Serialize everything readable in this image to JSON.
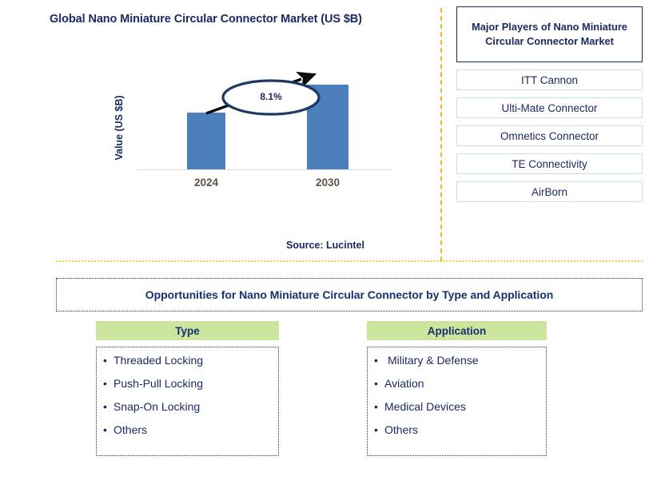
{
  "chart_title": "Global Nano Miniature Circular Connector Market (US $B)",
  "source_note": "Source: Lucintel",
  "chart_data": {
    "type": "bar",
    "title": "Global Nano Miniature Circular Connector Market (US $B)",
    "categories": [
      "2024",
      "2030"
    ],
    "values": [
      60,
      90
    ],
    "series": [
      {
        "name": "Value (US $B)",
        "values": [
          60,
          90
        ]
      }
    ],
    "xlabel": "",
    "ylabel": "Value (US $B)",
    "ylim": [
      0,
      100
    ],
    "grid": false,
    "legend": "none",
    "bar_color": "#4d7fbd",
    "annotations": [
      {
        "text": "8.1%",
        "type": "cagr-callout",
        "between": [
          "2024",
          "2030"
        ]
      }
    ]
  },
  "axis": {
    "y_label": "Value (US $B)",
    "x_ticks": [
      "2024",
      "2030"
    ]
  },
  "cagr": {
    "value": "8.1%"
  },
  "players": {
    "title": "Major Players of Nano Miniature Circular Connector Market",
    "items": [
      {
        "label": "ITT Cannon"
      },
      {
        "label": "Ulti-Mate Connector"
      },
      {
        "label": "Omnetics Connector"
      },
      {
        "label": "TE Connectivity"
      },
      {
        "label": "AirBorn"
      }
    ]
  },
  "opportunities": {
    "banner": "Opportunities for Nano Miniature Circular Connector by Type and Application",
    "columns": [
      {
        "header": "Type",
        "items": [
          "Threaded Locking",
          "Push-Pull Locking",
          "Snap-On Locking",
          "Others"
        ]
      },
      {
        "header": "Application",
        "items": [
          "Military & Defense",
          "Aviation",
          "Medical Devices",
          "Others"
        ]
      }
    ]
  },
  "colors": {
    "navy": "#1b2a63",
    "bar_blue": "#4d7fbd",
    "divider_orange": "#f5b726",
    "header_green": "#cbe59e",
    "player_border": "#c9dcec"
  }
}
